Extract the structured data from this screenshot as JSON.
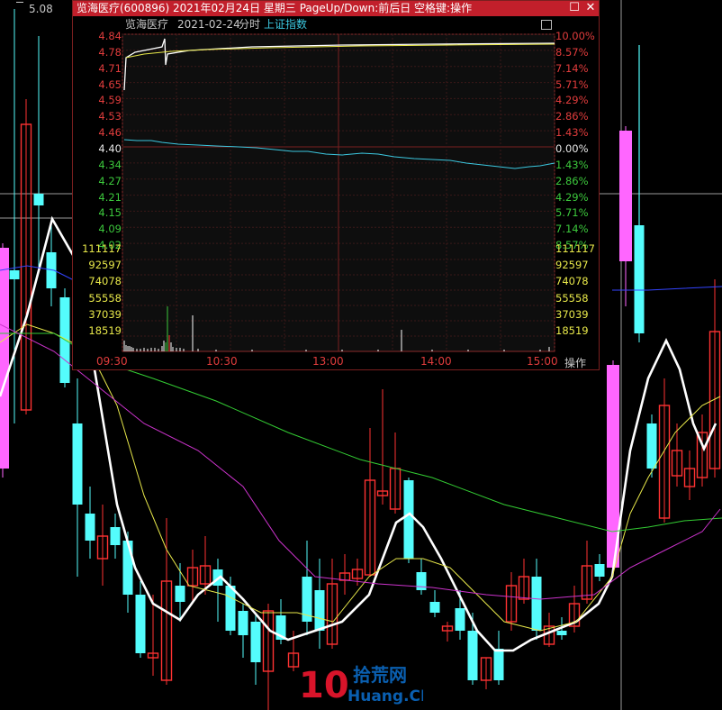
{
  "main_chart": {
    "top_price": "5.08"
  },
  "popup": {
    "title": "览海医疗(600896) 2021年02月24日 星期三 PageUp/Down:前后日 空格键:操作",
    "stock_name": "览海医疗",
    "date": "2021-02-24",
    "chart_kind": "分时",
    "index_link": "上证指数",
    "price_axis": [
      {
        "label": "4.84",
        "color": "#e03c3c"
      },
      {
        "label": "4.78",
        "color": "#e03c3c"
      },
      {
        "label": "4.71",
        "color": "#e03c3c"
      },
      {
        "label": "4.65",
        "color": "#e03c3c"
      },
      {
        "label": "4.59",
        "color": "#e03c3c"
      },
      {
        "label": "4.53",
        "color": "#e03c3c"
      },
      {
        "label": "4.46",
        "color": "#e03c3c"
      },
      {
        "label": "4.40",
        "color": "#e6e6e6"
      },
      {
        "label": "4.34",
        "color": "#3cc83c"
      },
      {
        "label": "4.27",
        "color": "#3cc83c"
      },
      {
        "label": "4.21",
        "color": "#3cc83c"
      },
      {
        "label": "4.15",
        "color": "#3cc83c"
      },
      {
        "label": "4.09",
        "color": "#3cc83c"
      },
      {
        "label": "4.02",
        "color": "#3cc83c"
      }
    ],
    "pct_axis": [
      {
        "label": "10.00%",
        "color": "#e03c3c"
      },
      {
        "label": "8.57%",
        "color": "#e03c3c"
      },
      {
        "label": "7.14%",
        "color": "#e03c3c"
      },
      {
        "label": "5.71%",
        "color": "#e03c3c"
      },
      {
        "label": "4.29%",
        "color": "#e03c3c"
      },
      {
        "label": "2.86%",
        "color": "#e03c3c"
      },
      {
        "label": "1.43%",
        "color": "#e03c3c"
      },
      {
        "label": "0.00%",
        "color": "#e6e6e6"
      },
      {
        "label": "1.43%",
        "color": "#3cc83c"
      },
      {
        "label": "2.86%",
        "color": "#3cc83c"
      },
      {
        "label": "4.29%",
        "color": "#3cc83c"
      },
      {
        "label": "5.71%",
        "color": "#3cc83c"
      },
      {
        "label": "7.14%",
        "color": "#3cc83c"
      },
      {
        "label": "8.57%",
        "color": "#3cc83c"
      }
    ],
    "volume_axis": [
      "111117",
      "92597",
      "74078",
      "55558",
      "37039",
      "18519"
    ],
    "volume_axis_color": "#e8e84a",
    "time_axis": [
      "09:30",
      "10:30",
      "13:00",
      "14:00",
      "15:00"
    ],
    "operate_label": "操作"
  },
  "watermark": {
    "number": "10",
    "cn": "拾荒网",
    "en": "Huang.CN"
  },
  "colors": {
    "up": "#ff3232",
    "down": "#54fcfc",
    "magenta_bar": "#ff66ff",
    "ma_white": "#ffffff",
    "ma_yellow": "#e8e84a",
    "ma_green": "#33cc33",
    "ma_magenta": "#cc33cc",
    "ma_blue": "#3344ff"
  }
}
